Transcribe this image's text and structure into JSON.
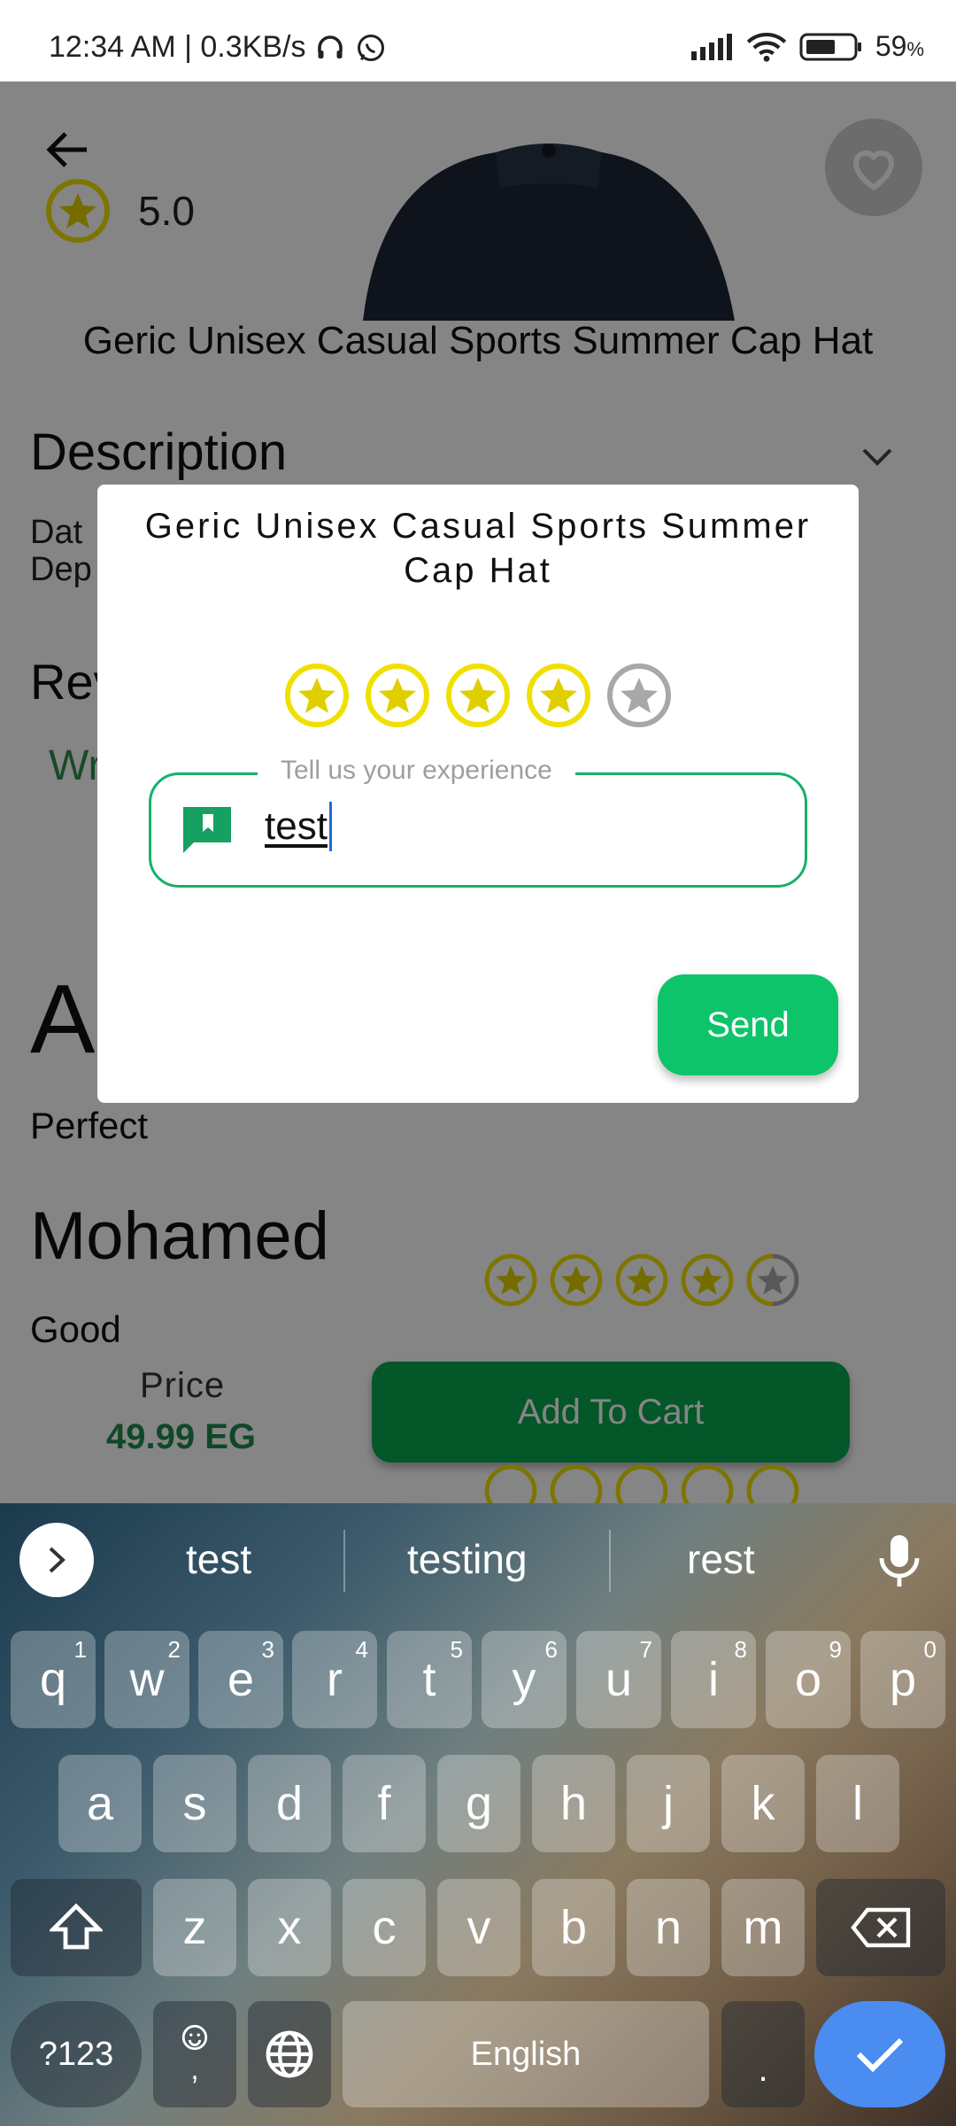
{
  "status_bar": {
    "time_speed": "12:34 AM | 0.3KB/s",
    "battery": "59",
    "battery_unit": "%"
  },
  "product": {
    "rating": "5.0",
    "title": "Geric Unisex Casual Sports Summer Cap Hat",
    "description_heading": "Description",
    "description_partial_1": "Dat",
    "description_partial_2": "Dep",
    "reviews_heading_partial": "Rev",
    "write_review_partial": "Wr",
    "big_letter": "A",
    "review_1_text": "Perfect",
    "review_2_name": "Mohamed",
    "review_2_text": "Good",
    "price_label": "Price",
    "price_value": "49.99 EG",
    "add_to_cart": "Add To Cart"
  },
  "dialog": {
    "title": "Geric Unisex Casual Sports Summer Cap Hat",
    "stars_selected": 4,
    "stars_total": 5,
    "field_label": "Tell us your experience",
    "field_value": "test",
    "send_label": "Send"
  },
  "keyboard": {
    "suggestions": [
      "test",
      "testing",
      "rest"
    ],
    "row1": [
      "q",
      "w",
      "e",
      "r",
      "t",
      "y",
      "u",
      "i",
      "o",
      "p"
    ],
    "row1_hints": [
      "1",
      "2",
      "3",
      "4",
      "5",
      "6",
      "7",
      "8",
      "9",
      "0"
    ],
    "row2": [
      "a",
      "s",
      "d",
      "f",
      "g",
      "h",
      "j",
      "k",
      "l"
    ],
    "row3": [
      "z",
      "x",
      "c",
      "v",
      "b",
      "n",
      "m"
    ],
    "symbols_key": "?123",
    "comma_key": ",",
    "space_label": "English",
    "period_key": "."
  },
  "colors": {
    "accent_green": "#0dc46a",
    "star_yellow": "#f0e000",
    "star_gray": "#a8a8a8",
    "keyboard_enter": "#4a8cf0"
  }
}
